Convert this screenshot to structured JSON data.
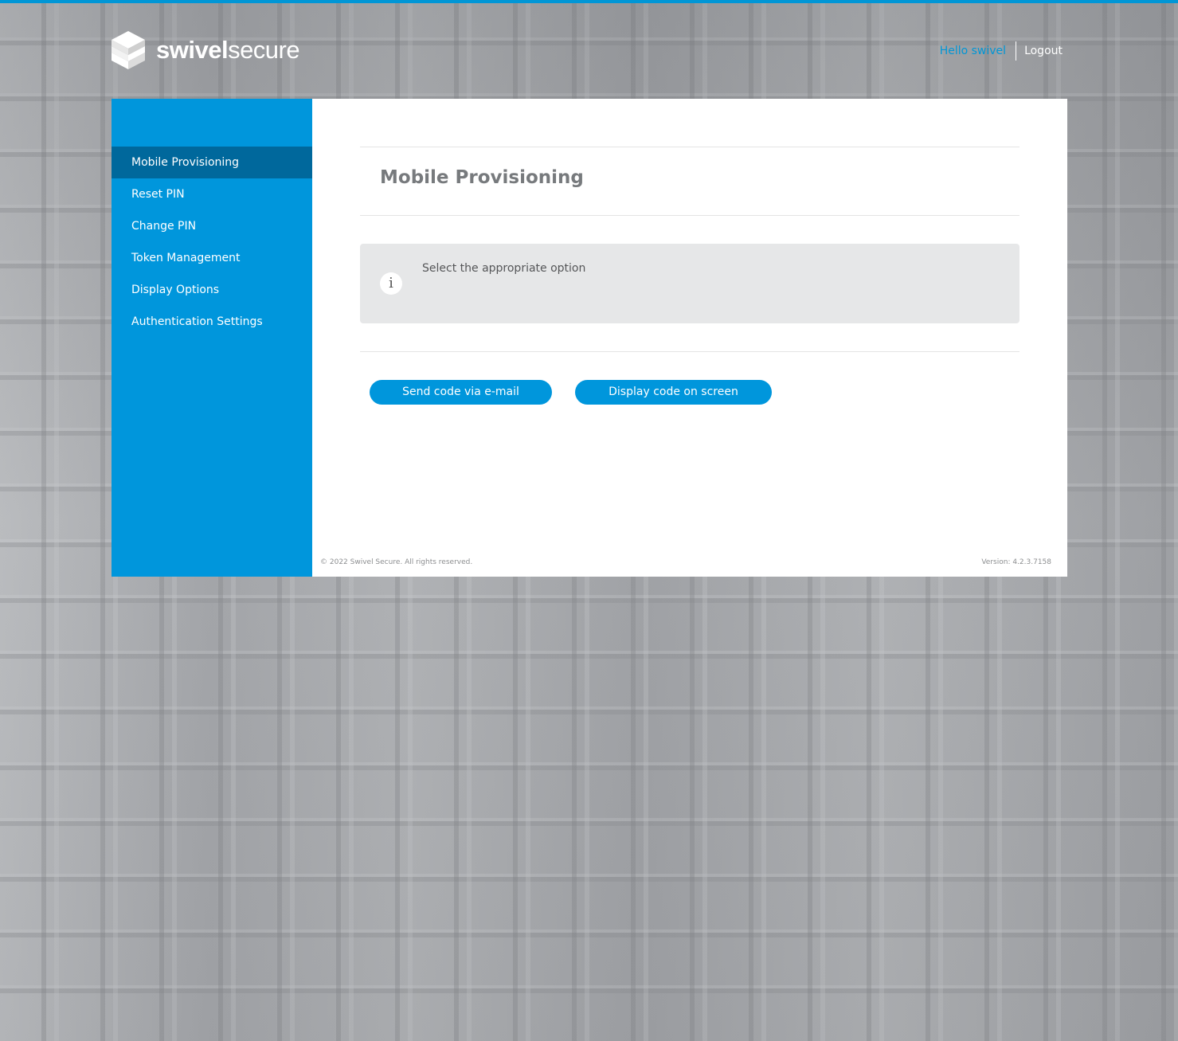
{
  "brand": {
    "name_bold": "swivel",
    "name_light": "secure",
    "logo_icon": "swivel-cube-logo-icon",
    "accent_color": "#0096dc"
  },
  "header": {
    "greeting": "Hello swivel",
    "logout_label": "Logout"
  },
  "sidebar": {
    "items": [
      {
        "label": "Mobile Provisioning",
        "active": true
      },
      {
        "label": "Reset PIN",
        "active": false
      },
      {
        "label": "Change PIN",
        "active": false
      },
      {
        "label": "Token Management",
        "active": false
      },
      {
        "label": "Display Options",
        "active": false
      },
      {
        "label": "Authentication Settings",
        "active": false
      }
    ]
  },
  "main": {
    "title": "Mobile Provisioning",
    "info": {
      "icon": "info-icon",
      "icon_glyph": "i",
      "message": "Select the appropriate option"
    },
    "buttons": {
      "email_label": "Send code via e-mail",
      "screen_label": "Display code on screen"
    }
  },
  "footer": {
    "copyright": "© 2022 Swivel Secure. All rights reserved.",
    "version": "Version: 4.2.3.7158"
  }
}
